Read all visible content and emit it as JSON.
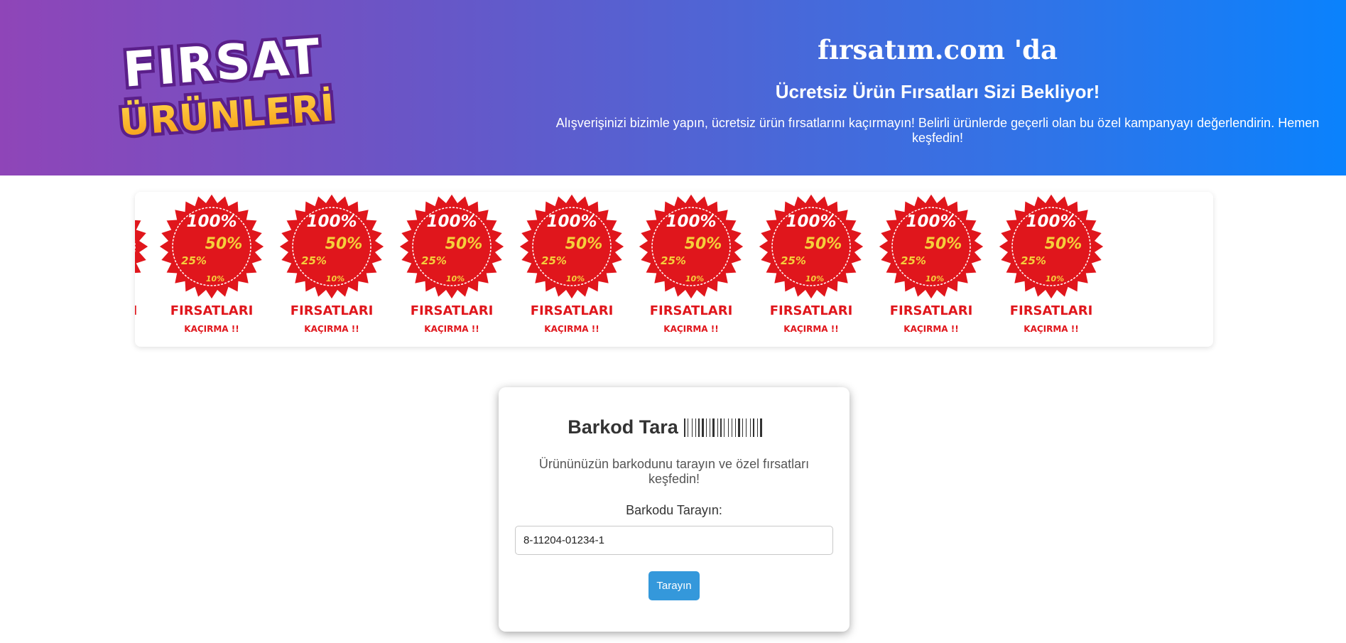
{
  "header": {
    "logo_line1": "FIRSAT",
    "logo_line2": "ÜRÜNLERİ",
    "site_name": "fırsatım.com 'da",
    "subtitle": "Ücretsiz Ürün Fırsatları Sizi Bekliyor!",
    "description": "Alışverişinizi bizimle yapın, ücretsiz ürün fırsatlarını kaçırmayın! Belirli ürünlerde geçerli olan bu özel kampanyayı değerlendirin. Hemen keşfedin!"
  },
  "banner": {
    "badge": {
      "pct1": "100%",
      "pct2": "50%",
      "pct3": "25%",
      "pct4": "10%",
      "title": "FIRSATLARI",
      "subtitle": "KAÇIRMA !!"
    }
  },
  "scanner": {
    "title": "Barkod Tara",
    "icon": "barcode-icon",
    "description": "Ürününüzün barkodunu tarayın ve özel fırsatları keşfedin!",
    "field_label": "Barkodu Tarayın:",
    "input_value": "8-11204-01234-1",
    "button_label": "Tarayın"
  },
  "colors": {
    "header_start": "#8f45b8",
    "header_end": "#0a82fd",
    "badge_red": "#e0161c",
    "badge_yellow": "#f5cf3b",
    "button_blue": "#3498db"
  }
}
